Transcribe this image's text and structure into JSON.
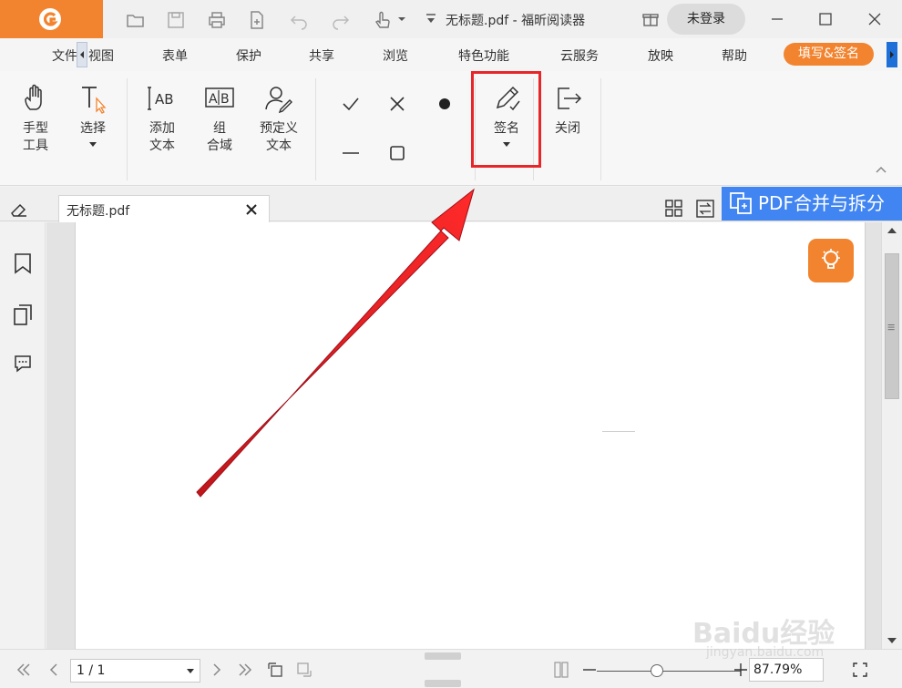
{
  "titlebar": {
    "title": "无标题.pdf - 福昕阅读器",
    "login_label": "未登录"
  },
  "menu": {
    "items": [
      "文件",
      "视图",
      "表单",
      "保护",
      "共享",
      "浏览",
      "特色功能",
      "云服务",
      "放映",
      "帮助"
    ],
    "active": "填写&签名"
  },
  "ribbon": {
    "hand_tool": "手型\n工具",
    "select_tool": "选择",
    "add_text": "添加\n文本",
    "combo_field": "组\n合域",
    "predefined_text": "预定义\n文本",
    "sign": "签名",
    "close": "关闭"
  },
  "tabs": {
    "doc_tab": "无标题.pdf",
    "merge_label": "PDF合并与拆分"
  },
  "status": {
    "page": "1 / 1",
    "zoom": "87.79%"
  },
  "watermark": {
    "text": "Baidu经验",
    "url": "jingyan.baidu.com"
  },
  "colors": {
    "brand_orange": "#f2842f",
    "highlight_red": "#e8262a",
    "merge_blue": "#4185f2"
  }
}
